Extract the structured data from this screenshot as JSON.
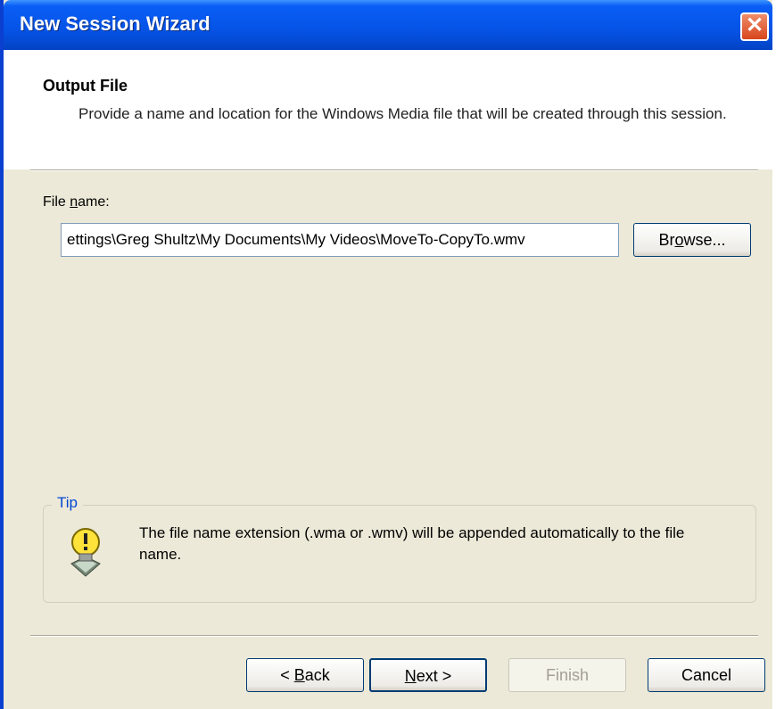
{
  "window": {
    "title": "New Session Wizard"
  },
  "header": {
    "title": "Output File",
    "description": "Provide a name and location for the Windows Media file that will be created through this session."
  },
  "form": {
    "file_label_pre": "File ",
    "file_label_accel": "n",
    "file_label_post": "ame:",
    "file_value": "ettings\\Greg Shultz\\My Documents\\My Videos\\MoveTo-CopyTo.wmv",
    "browse_pre": "Br",
    "browse_accel": "o",
    "browse_post": "wse..."
  },
  "tip": {
    "legend": "Tip",
    "text": "The file name extension (.wma or .wmv) will be appended automatically to the file name.",
    "icon": "lightbulb-icon"
  },
  "footer": {
    "back_prefix": "< ",
    "back_accel": "B",
    "back_rest": "ack",
    "next_accel": "N",
    "next_rest": "ext >",
    "finish": "Finish",
    "cancel": "Cancel"
  },
  "colors": {
    "titlebar": "#0553e6",
    "dialog": "#ece9d8",
    "tip_legend": "#0046d5"
  }
}
